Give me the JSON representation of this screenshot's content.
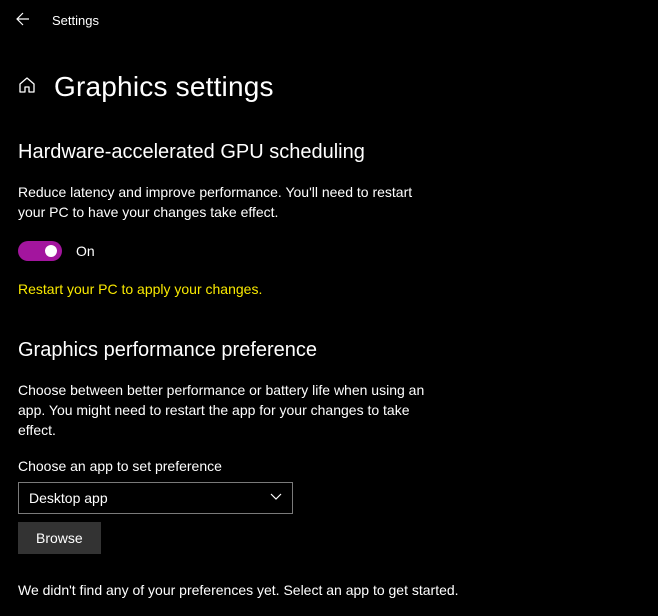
{
  "header": {
    "title": "Settings"
  },
  "page": {
    "title": "Graphics settings"
  },
  "section1": {
    "title": "Hardware-accelerated GPU scheduling",
    "description": "Reduce latency and improve performance. You'll need to restart your PC to have your changes take effect.",
    "toggle_state": "On",
    "warning": "Restart your PC to apply your changes."
  },
  "section2": {
    "title": "Graphics performance preference",
    "description": "Choose between better performance or battery life when using an app. You might need to restart the app for your changes to take effect.",
    "select_label": "Choose an app to set preference",
    "select_value": "Desktop app",
    "browse_label": "Browse",
    "empty_text": "We didn't find any of your preferences yet. Select an app to get started."
  }
}
